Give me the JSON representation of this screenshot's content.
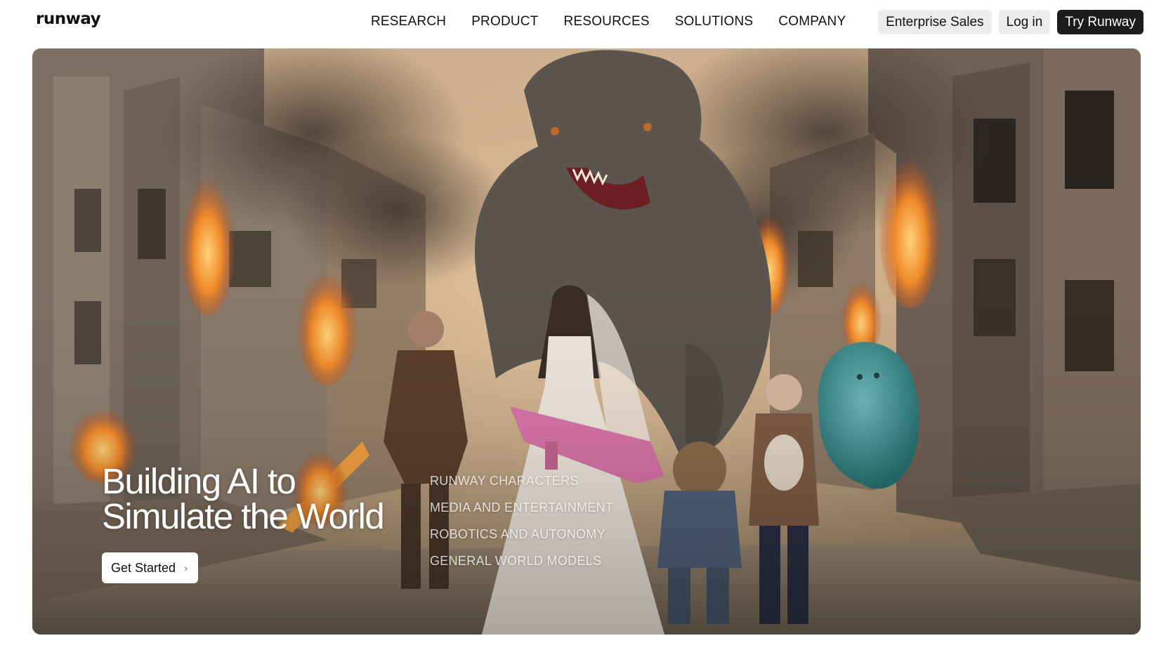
{
  "header": {
    "logo": "runway",
    "nav": [
      "RESEARCH",
      "PRODUCT",
      "RESOURCES",
      "SOLUTIONS",
      "COMPANY"
    ],
    "enterprise_label": "Enterprise Sales",
    "login_label": "Log in",
    "try_label": "Try Runway"
  },
  "hero": {
    "headline_line1": "Building AI to",
    "headline_line2": "Simulate the World",
    "cta_label": "Get Started",
    "cta_icon": "chevron-right-icon",
    "links": [
      "RUNWAY CHARACTERS",
      "MEDIA AND ENTERTAINMENT",
      "ROBOTICS AND AUTONOMY",
      "GENERAL WORLD MODELS"
    ]
  },
  "colors": {
    "primary_button": "#1c1c1c",
    "secondary_button": "#ececec",
    "text": "#111111"
  }
}
